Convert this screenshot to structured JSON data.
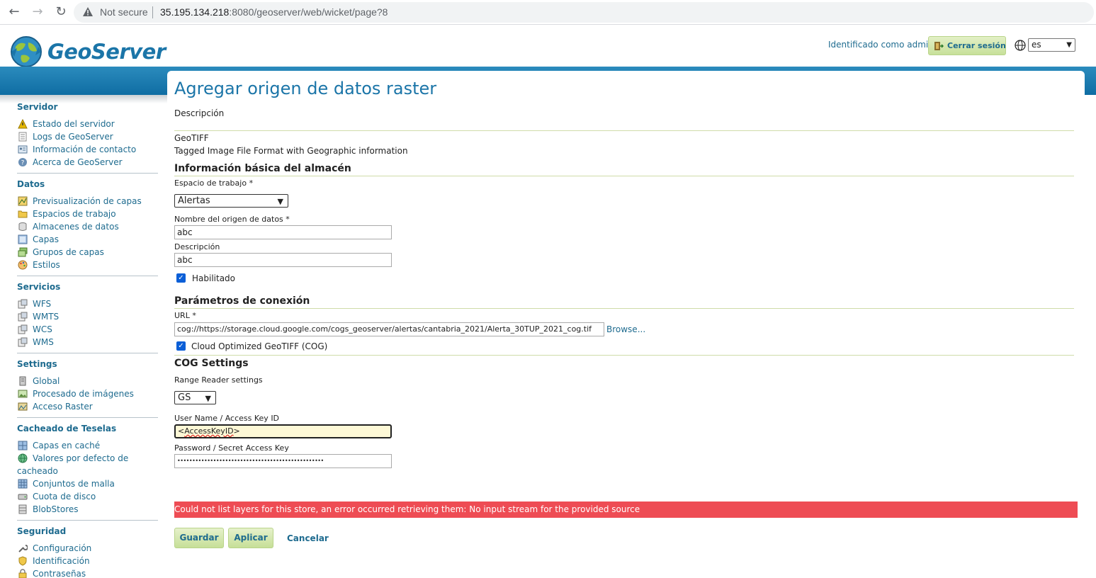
{
  "browser": {
    "security_label": "Not secure",
    "url_host": "35.195.134.218",
    "url_rest": ":8080/geoserver/web/wicket/page?8"
  },
  "header": {
    "logo_text": "GeoServer",
    "identified_as": "Identificado como admin.",
    "logout_label": "Cerrar sesión",
    "language": "es"
  },
  "sidebar": {
    "servidor": {
      "title": "Servidor",
      "items": [
        "Estado del servidor",
        "Logs de GeoServer",
        "Información de contacto",
        "Acerca de GeoServer"
      ]
    },
    "datos": {
      "title": "Datos",
      "items": [
        "Previsualización de capas",
        "Espacios de trabajo",
        "Almacenes de datos",
        "Capas",
        "Grupos de capas",
        "Estilos"
      ]
    },
    "servicios": {
      "title": "Servicios",
      "items": [
        "WFS",
        "WMTS",
        "WCS",
        "WMS"
      ]
    },
    "settings": {
      "title": "Settings",
      "items": [
        "Global",
        "Procesado de imágenes",
        "Acceso Raster"
      ]
    },
    "cacheado": {
      "title": "Cacheado de Teselas",
      "items": [
        "Capas en caché",
        "Valores por defecto de",
        "cacheado",
        "Conjuntos de malla",
        "Cuota de disco",
        "BlobStores"
      ]
    },
    "seguridad": {
      "title": "Seguridad",
      "items": [
        "Configuración",
        "Identificación",
        "Contraseñas"
      ]
    }
  },
  "main": {
    "title": "Agregar origen de datos raster",
    "description_label": "Descripción",
    "format_name": "GeoTIFF",
    "format_desc": "Tagged Image File Format with Geographic information",
    "basic_info_title": "Información básica del almacén",
    "workspace_label": "Espacio de trabajo *",
    "workspace_value": "Alertas",
    "datasource_name_label": "Nombre del origen de datos *",
    "datasource_name_value": "abc",
    "description_field_label": "Descripción",
    "description_value": "abc",
    "enabled_label": "Habilitado",
    "connection_title": "Parámetros de conexión",
    "url_label": "URL *",
    "url_value": "cog://https://storage.cloud.google.com/cogs_geoserver/alertas/cantabria_2021/Alerta_30TUP_2021_cog.tif",
    "browse_label": "Browse...",
    "cog_label": "Cloud Optimized GeoTIFF (COG)",
    "cog_settings_title": "COG Settings",
    "range_reader_label": "Range Reader settings",
    "range_reader_value": "GS",
    "username_label": "User Name / Access Key ID",
    "username_prefix": "<",
    "username_word": "AccessKeyID",
    "username_suffix": ">",
    "password_label": "Password / Secret Access Key",
    "password_value": "•••••••••••••••••••••••••••••••••••••••••••••••••",
    "error_message": "Could not list layers for this store, an error occurred retrieving them: No input stream for the provided source",
    "save_label": "Guardar",
    "apply_label": "Aplicar",
    "cancel_label": "Cancelar"
  },
  "colors": {
    "accent": "#1b75a8",
    "link": "#1e6b8f",
    "header_band": "#0f6da3",
    "error": "#ee4c54",
    "button": "#c6df97"
  }
}
